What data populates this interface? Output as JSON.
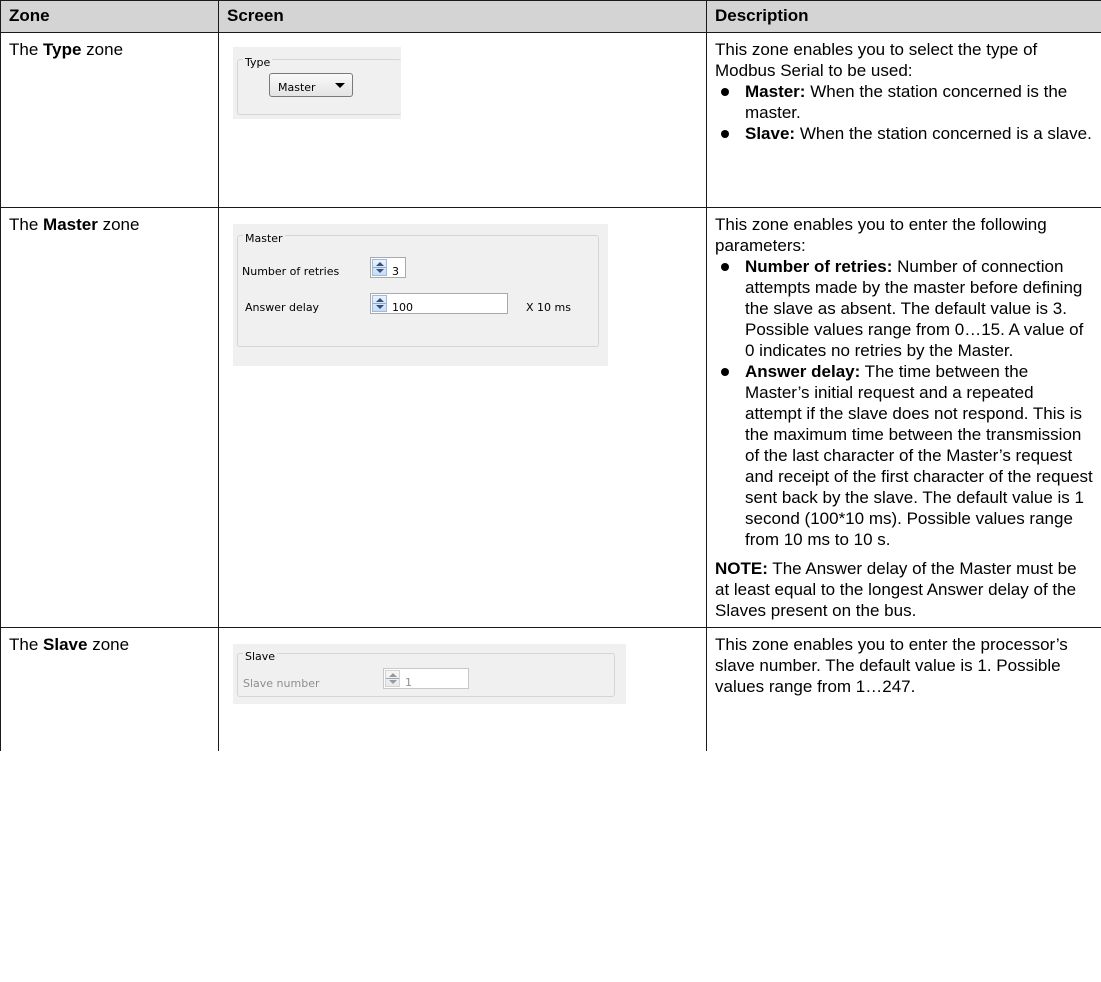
{
  "headers": {
    "zone": "Zone",
    "screen": "Screen",
    "description": "Description"
  },
  "rows": {
    "type": {
      "zone_prefix": "The ",
      "zone_bold": "Type",
      "zone_suffix": " zone",
      "screen": {
        "group_label": "Type",
        "combo_value": "Master"
      },
      "desc_intro": "This zone enables you to select the type of Modbus Serial to be used:",
      "items": [
        {
          "term": "Master:",
          "text": " When the station concerned is the master."
        },
        {
          "term": "Slave:",
          "text": " When the station concerned is a slave."
        }
      ]
    },
    "master": {
      "zone_prefix": "The ",
      "zone_bold": "Master",
      "zone_suffix": " zone",
      "screen": {
        "group_label": "Master",
        "retries_label": "Number of retries",
        "retries_value": "3",
        "delay_label": "Answer delay",
        "delay_value": "100",
        "delay_unit": "X 10 ms"
      },
      "desc_intro": "This zone enables you to enter the following parameters:",
      "items": [
        {
          "term": "Number of retries:",
          "text": " Number of connection attempts made by the master before defining the slave as absent. The default value is 3. Possible values range from 0…15. A value of 0 indicates no retries by the Master."
        },
        {
          "term": "Answer delay:",
          "text": " The time between the Master’s initial request and a repeated attempt if the slave does not respond. This is the maximum time between the transmission of the last character of the Master’s request and receipt of the first character of the request sent back by the slave. The default value is 1 second (100*10 ms). Possible values range from 10 ms to 10 s."
        }
      ],
      "note_label": "NOTE:",
      "note_text": " The Answer delay of the Master must be at least equal to the longest Answer delay of the Slaves present on the bus."
    },
    "slave": {
      "zone_prefix": "The ",
      "zone_bold": "Slave",
      "zone_suffix": " zone",
      "screen": {
        "group_label": "Slave",
        "number_label": "Slave number",
        "number_value": "1"
      },
      "desc_intro": "This zone enables you to enter the processor’s slave number. The default value is 1. Possible values range from 1…247."
    }
  }
}
